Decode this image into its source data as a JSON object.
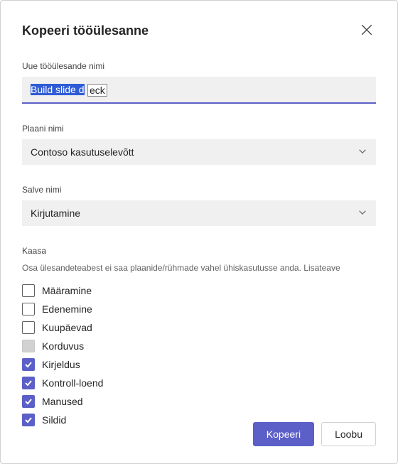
{
  "dialog": {
    "title": "Kopeeri tööülesanne"
  },
  "fields": {
    "name_label": "Uue tööülesande nimi",
    "name_value_selected": "Build slide d",
    "name_value_rest": "eck",
    "plan_label": "Plaani nimi",
    "plan_value": "Contoso kasutuselevõtt",
    "bucket_label": "Salve nimi",
    "bucket_value": "Kirjutamine"
  },
  "include": {
    "label": "Kaasa",
    "help": "Osa ülesandeteabest ei saa plaanide/rühmade vahel ühiskasutusse anda. Lisateave",
    "items": [
      {
        "label": "Määramine",
        "checked": false,
        "disabled": false
      },
      {
        "label": "Edenemine",
        "checked": false,
        "disabled": false
      },
      {
        "label": "Kuupäevad",
        "checked": false,
        "disabled": false
      },
      {
        "label": "Korduvus",
        "checked": false,
        "disabled": true
      },
      {
        "label": "Kirjeldus",
        "checked": true,
        "disabled": false
      },
      {
        "label": "Kontroll-loend",
        "checked": true,
        "disabled": false
      },
      {
        "label": "Manused",
        "checked": true,
        "disabled": false
      },
      {
        "label": "Sildid",
        "checked": true,
        "disabled": false
      }
    ]
  },
  "buttons": {
    "primary": "Kopeeri",
    "secondary": "Loobu"
  }
}
